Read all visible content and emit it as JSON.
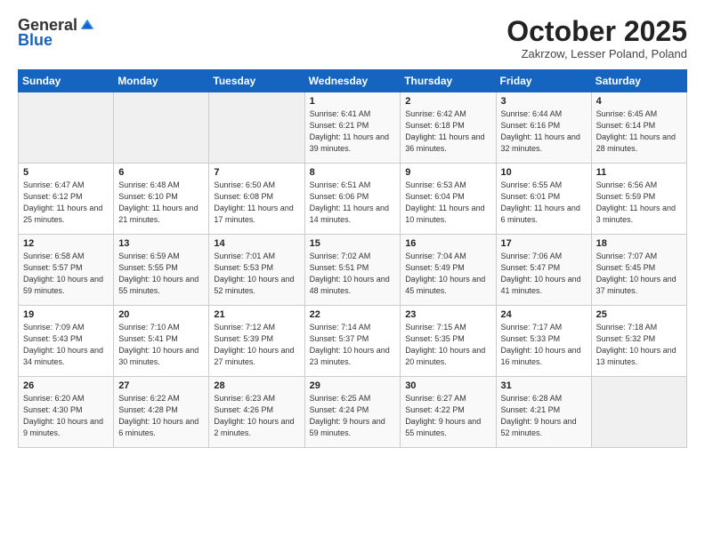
{
  "logo": {
    "general": "General",
    "blue": "Blue"
  },
  "header": {
    "month": "October 2025",
    "location": "Zakrzow, Lesser Poland, Poland"
  },
  "weekdays": [
    "Sunday",
    "Monday",
    "Tuesday",
    "Wednesday",
    "Thursday",
    "Friday",
    "Saturday"
  ],
  "weeks": [
    [
      {
        "num": "",
        "info": ""
      },
      {
        "num": "",
        "info": ""
      },
      {
        "num": "",
        "info": ""
      },
      {
        "num": "1",
        "info": "Sunrise: 6:41 AM\nSunset: 6:21 PM\nDaylight: 11 hours\nand 39 minutes."
      },
      {
        "num": "2",
        "info": "Sunrise: 6:42 AM\nSunset: 6:18 PM\nDaylight: 11 hours\nand 36 minutes."
      },
      {
        "num": "3",
        "info": "Sunrise: 6:44 AM\nSunset: 6:16 PM\nDaylight: 11 hours\nand 32 minutes."
      },
      {
        "num": "4",
        "info": "Sunrise: 6:45 AM\nSunset: 6:14 PM\nDaylight: 11 hours\nand 28 minutes."
      }
    ],
    [
      {
        "num": "5",
        "info": "Sunrise: 6:47 AM\nSunset: 6:12 PM\nDaylight: 11 hours\nand 25 minutes."
      },
      {
        "num": "6",
        "info": "Sunrise: 6:48 AM\nSunset: 6:10 PM\nDaylight: 11 hours\nand 21 minutes."
      },
      {
        "num": "7",
        "info": "Sunrise: 6:50 AM\nSunset: 6:08 PM\nDaylight: 11 hours\nand 17 minutes."
      },
      {
        "num": "8",
        "info": "Sunrise: 6:51 AM\nSunset: 6:06 PM\nDaylight: 11 hours\nand 14 minutes."
      },
      {
        "num": "9",
        "info": "Sunrise: 6:53 AM\nSunset: 6:04 PM\nDaylight: 11 hours\nand 10 minutes."
      },
      {
        "num": "10",
        "info": "Sunrise: 6:55 AM\nSunset: 6:01 PM\nDaylight: 11 hours\nand 6 minutes."
      },
      {
        "num": "11",
        "info": "Sunrise: 6:56 AM\nSunset: 5:59 PM\nDaylight: 11 hours\nand 3 minutes."
      }
    ],
    [
      {
        "num": "12",
        "info": "Sunrise: 6:58 AM\nSunset: 5:57 PM\nDaylight: 10 hours\nand 59 minutes."
      },
      {
        "num": "13",
        "info": "Sunrise: 6:59 AM\nSunset: 5:55 PM\nDaylight: 10 hours\nand 55 minutes."
      },
      {
        "num": "14",
        "info": "Sunrise: 7:01 AM\nSunset: 5:53 PM\nDaylight: 10 hours\nand 52 minutes."
      },
      {
        "num": "15",
        "info": "Sunrise: 7:02 AM\nSunset: 5:51 PM\nDaylight: 10 hours\nand 48 minutes."
      },
      {
        "num": "16",
        "info": "Sunrise: 7:04 AM\nSunset: 5:49 PM\nDaylight: 10 hours\nand 45 minutes."
      },
      {
        "num": "17",
        "info": "Sunrise: 7:06 AM\nSunset: 5:47 PM\nDaylight: 10 hours\nand 41 minutes."
      },
      {
        "num": "18",
        "info": "Sunrise: 7:07 AM\nSunset: 5:45 PM\nDaylight: 10 hours\nand 37 minutes."
      }
    ],
    [
      {
        "num": "19",
        "info": "Sunrise: 7:09 AM\nSunset: 5:43 PM\nDaylight: 10 hours\nand 34 minutes."
      },
      {
        "num": "20",
        "info": "Sunrise: 7:10 AM\nSunset: 5:41 PM\nDaylight: 10 hours\nand 30 minutes."
      },
      {
        "num": "21",
        "info": "Sunrise: 7:12 AM\nSunset: 5:39 PM\nDaylight: 10 hours\nand 27 minutes."
      },
      {
        "num": "22",
        "info": "Sunrise: 7:14 AM\nSunset: 5:37 PM\nDaylight: 10 hours\nand 23 minutes."
      },
      {
        "num": "23",
        "info": "Sunrise: 7:15 AM\nSunset: 5:35 PM\nDaylight: 10 hours\nand 20 minutes."
      },
      {
        "num": "24",
        "info": "Sunrise: 7:17 AM\nSunset: 5:33 PM\nDaylight: 10 hours\nand 16 minutes."
      },
      {
        "num": "25",
        "info": "Sunrise: 7:18 AM\nSunset: 5:32 PM\nDaylight: 10 hours\nand 13 minutes."
      }
    ],
    [
      {
        "num": "26",
        "info": "Sunrise: 6:20 AM\nSunset: 4:30 PM\nDaylight: 10 hours\nand 9 minutes."
      },
      {
        "num": "27",
        "info": "Sunrise: 6:22 AM\nSunset: 4:28 PM\nDaylight: 10 hours\nand 6 minutes."
      },
      {
        "num": "28",
        "info": "Sunrise: 6:23 AM\nSunset: 4:26 PM\nDaylight: 10 hours\nand 2 minutes."
      },
      {
        "num": "29",
        "info": "Sunrise: 6:25 AM\nSunset: 4:24 PM\nDaylight: 9 hours\nand 59 minutes."
      },
      {
        "num": "30",
        "info": "Sunrise: 6:27 AM\nSunset: 4:22 PM\nDaylight: 9 hours\nand 55 minutes."
      },
      {
        "num": "31",
        "info": "Sunrise: 6:28 AM\nSunset: 4:21 PM\nDaylight: 9 hours\nand 52 minutes."
      },
      {
        "num": "",
        "info": ""
      }
    ]
  ]
}
